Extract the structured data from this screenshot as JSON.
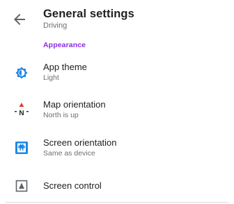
{
  "header": {
    "back_icon": "arrow-back-icon",
    "title": "General settings",
    "subtitle": "Driving"
  },
  "section": {
    "title": "Appearance",
    "color": "#8a2be2"
  },
  "items": [
    {
      "icon": "theme-icon",
      "label": "App theme",
      "value": "Light"
    },
    {
      "icon": "compass-north-icon",
      "label": "Map orientation",
      "value": "North is up"
    },
    {
      "icon": "phone-device-icon",
      "label": "Screen orientation",
      "value": "Same as device"
    },
    {
      "icon": "screen-control-icon",
      "label": "Screen control",
      "value": ""
    }
  ],
  "colors": {
    "accent": "#8a2be2",
    "icon_blue": "#1e88e5",
    "compass_red": "#e53935",
    "text_primary": "#202124",
    "text_secondary": "#6f6f6f"
  }
}
